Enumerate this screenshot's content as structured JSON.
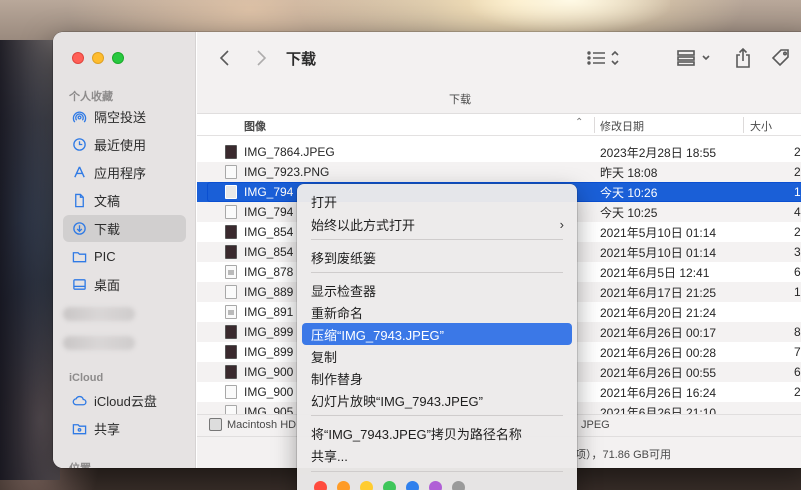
{
  "colors": {
    "accent": "#1a5fd7",
    "menu_highlight": "#3b78e7",
    "sidebar_icon": "#2f7ae5",
    "tag_colors": [
      "#ff4b3e",
      "#ff9b26",
      "#ffcc2f",
      "#3ec65a",
      "#2f80ed",
      "#b05fd6",
      "#9a9a9a"
    ]
  },
  "sidebar": {
    "favorites_header": "个人收藏",
    "items": [
      {
        "label": "隔空投送",
        "icon": "airdrop-icon"
      },
      {
        "label": "最近使用",
        "icon": "clock-icon"
      },
      {
        "label": "应用程序",
        "icon": "applications-icon"
      },
      {
        "label": "文稿",
        "icon": "document-icon"
      },
      {
        "label": "下载",
        "icon": "download-icon",
        "active": true
      },
      {
        "label": "PIC",
        "icon": "folder-icon"
      },
      {
        "label": "桌面",
        "icon": "desktop-icon"
      }
    ],
    "icloud_header": "iCloud",
    "icloud_items": [
      {
        "label": "iCloud云盘",
        "icon": "cloud-icon"
      },
      {
        "label": "共享",
        "icon": "shared-folder-icon"
      }
    ],
    "location_header": "位置"
  },
  "toolbar": {
    "title": "下载",
    "back_icon": "chevron-left-icon",
    "forward_icon": "chevron-right-icon",
    "list_view_icon": "list-view-icon",
    "group_icon": "grid-group-icon",
    "share_icon": "share-icon",
    "tag_icon": "tag-icon"
  },
  "pathbar": {
    "folder": "下载"
  },
  "columns": {
    "name": "图像",
    "date": "修改日期",
    "size": "大小"
  },
  "files": [
    {
      "name": "IMG_7864.JPEG",
      "date": "2023年2月28日 18:55",
      "size": "2"
    },
    {
      "name": "IMG_7923.PNG",
      "date": "昨天 18:08",
      "size": "2"
    },
    {
      "name": "IMG_794",
      "date": "今天 10:26",
      "size": "1"
    },
    {
      "name": "IMG_794",
      "date": "今天 10:25",
      "size": "4"
    },
    {
      "name": "IMG_854",
      "date": "2021年5月10日 01:14",
      "size": "2"
    },
    {
      "name": "IMG_854",
      "date": "2021年5月10日 01:14",
      "size": "3"
    },
    {
      "name": "IMG_878",
      "date": "2021年6月5日 12:41",
      "size": "6"
    },
    {
      "name": "IMG_889",
      "date": "2021年6月17日 21:25",
      "size": "1"
    },
    {
      "name": "IMG_891",
      "date": "2021年6月20日 21:24",
      "size": ""
    },
    {
      "name": "IMG_899",
      "date": "2021年6月26日 00:17",
      "size": "8"
    },
    {
      "name": "IMG_899",
      "date": "2021年6月26日 00:28",
      "size": "7"
    },
    {
      "name": "IMG_900",
      "date": "2021年6月26日 00:55",
      "size": "6"
    },
    {
      "name": "IMG_900",
      "date": "2021年6月26日 16:24",
      "size": "2"
    },
    {
      "name": "IMG_905",
      "date": "2021年6月26日 21:10",
      "size": ""
    }
  ],
  "statusbar": {
    "path_disk": "Macintosh HD",
    "path_tail": "JPEG"
  },
  "footer": {
    "free_space": "项），71.86 GB可用"
  },
  "context_menu": {
    "open": "打开",
    "open_with": "始终以此方式打开",
    "open_with_arrow": "›",
    "move_to_trash": "移到废纸篓",
    "get_info": "显示检查器",
    "rename": "重新命名",
    "compress": "压缩“IMG_7943.JPEG”",
    "duplicate": "复制",
    "make_alias": "制作替身",
    "slideshow": "幻灯片放映“IMG_7943.JPEG”",
    "copy_path": "将“IMG_7943.JPEG”拷贝为路径名称",
    "share": "共享..."
  }
}
